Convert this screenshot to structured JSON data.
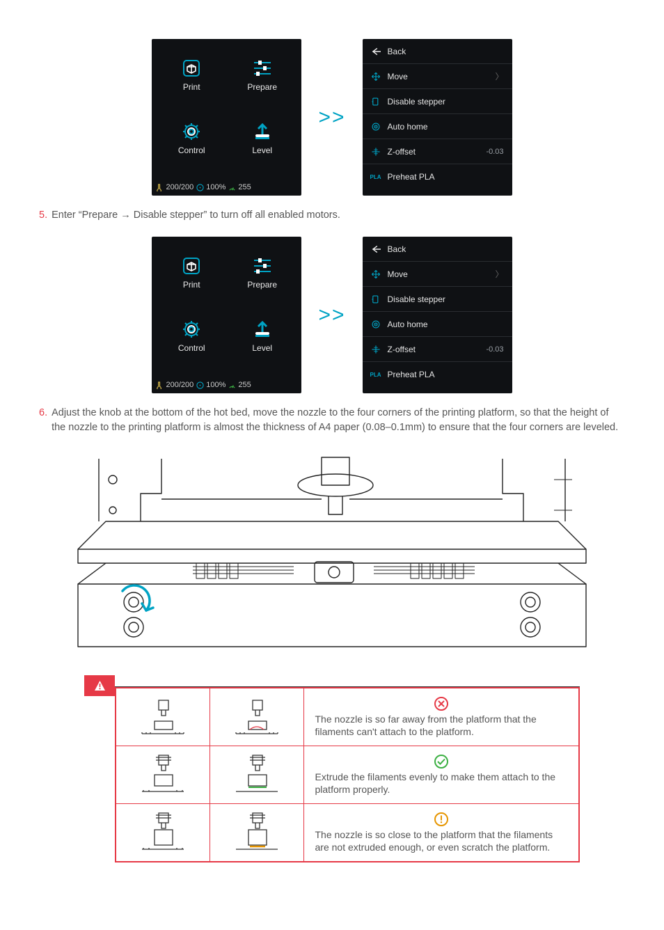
{
  "screens": {
    "home": {
      "tiles": {
        "print": "Print",
        "prepare": "Prepare",
        "control": "Control",
        "level": "Level"
      },
      "status": {
        "temp": "200/200",
        "fan": "100%",
        "speed": "255"
      }
    },
    "prepare_menu": {
      "back": "Back",
      "items": {
        "move": "Move",
        "disable_stepper": "Disable stepper",
        "auto_home": "Auto home",
        "zoffset": {
          "label": "Z-offset",
          "value": "-0.03"
        },
        "preheat_pla": {
          "tag": "PLA",
          "label": "Preheat PLA"
        }
      }
    }
  },
  "steps": {
    "s5": {
      "num": "5.",
      "text": "Enter “Prepare → Disable stepper” to turn off all enabled motors."
    },
    "s6": {
      "num": "6.",
      "text": "Adjust the knob at the bottom of the hot bed, move the nozzle to the four corners of the printing platform, so that the height of the nozzle to the printing platform is almost the thickness of A4 paper (0.08–0.1mm) to ensure that the four corners are leveled."
    }
  },
  "arrow": ">>",
  "warning_rows": [
    {
      "status": "bad",
      "text": "The nozzle is so far away from the platform that the filaments can't attach to the platform."
    },
    {
      "status": "good",
      "text": "Extrude the filaments evenly to make them attach to the platform properly."
    },
    {
      "status": "warn",
      "text": "The nozzle is so close to the platform that the filaments are not extruded enough, or even scratch the platform."
    }
  ]
}
